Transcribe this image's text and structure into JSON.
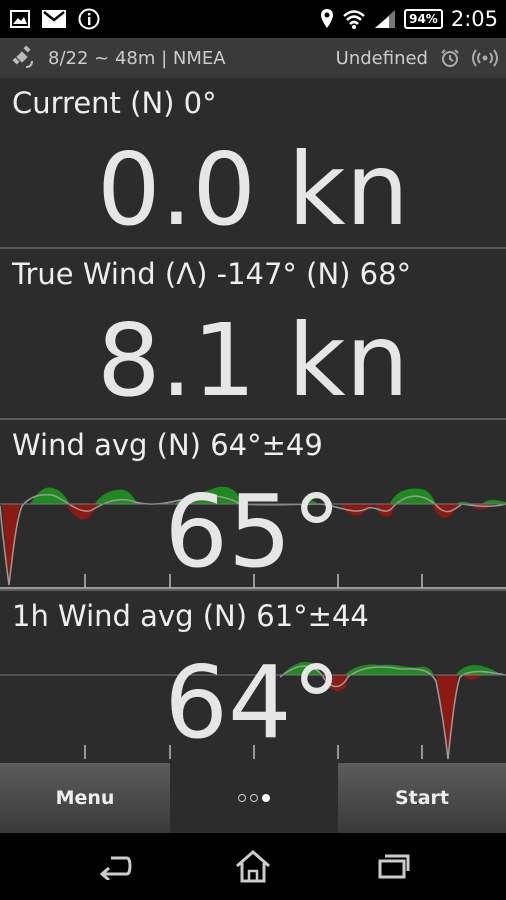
{
  "status_bar": {
    "icons_left": [
      "image-icon",
      "gmail-icon",
      "info-icon"
    ],
    "icons_right": [
      "location-icon",
      "wifi-icon",
      "signal-icon"
    ],
    "battery": "94%",
    "time": "2:05"
  },
  "header": {
    "status": "8/22 ~ 48m | NMEA",
    "mode": "Undefined"
  },
  "panels": [
    {
      "label": "Current (N) 0°",
      "value": "0.0 kn"
    },
    {
      "label": "True Wind (Λ) -147° (N) 68°",
      "value": "8.1 kn"
    },
    {
      "label": "Wind avg (N) 64°±49",
      "value": "65°"
    },
    {
      "label": "1h Wind avg (N) 61°±44",
      "value": "64°"
    }
  ],
  "colors": {
    "panel_bg": "#2c2c2c",
    "positive_fill": "#1f8a1f",
    "negative_fill": "#8b1a14",
    "trace": "#9a9a9a"
  },
  "action_bar": {
    "menu_label": "Menu",
    "start_label": "Start",
    "page_indicator": {
      "pages": 3,
      "active": 3
    }
  }
}
